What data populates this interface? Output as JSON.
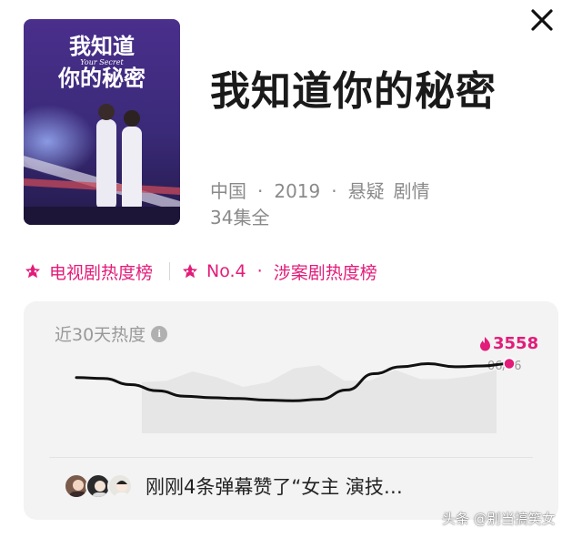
{
  "header": {
    "close_icon": "close-icon"
  },
  "poster": {
    "title_line1": "我知道",
    "title_line2": "你的秘密",
    "subtitle_en": "Your Secret"
  },
  "show": {
    "title": "我知道你的秘密",
    "country": "中国",
    "year": "2019",
    "genre1": "悬疑",
    "genre2": "剧情",
    "separator": "·",
    "episodes": "34集全"
  },
  "rankings": {
    "accent_color": "#e21c79",
    "items": [
      {
        "label": "电视剧热度榜",
        "icon": "star-icon"
      },
      {
        "label": "No.4",
        "icon": "star-icon"
      },
      {
        "label": "涉案剧热度榜"
      }
    ],
    "separator": "·"
  },
  "heat": {
    "title": "近30天热度",
    "info_icon": "info-icon",
    "value": "3558",
    "flame_icon": "flame-icon",
    "date": "06/06",
    "line_color": "#111111",
    "point_color": "#e21c79",
    "series": [
      0.72,
      0.71,
      0.63,
      0.55,
      0.48,
      0.46,
      0.45,
      0.43,
      0.42,
      0.44,
      0.56,
      0.77,
      0.86,
      0.9,
      0.86,
      0.87,
      0.9
    ],
    "background_series": [
      0.66,
      0.68,
      0.8,
      0.72,
      0.6,
      0.66,
      0.84,
      0.88,
      0.68,
      0.68,
      0.82,
      0.7,
      0.7,
      0.74,
      0.82
    ]
  },
  "comment": {
    "text": "刚刚4条弹幕赞了“女主  演技…"
  },
  "watermark": "头条 @别当搞笑女"
}
